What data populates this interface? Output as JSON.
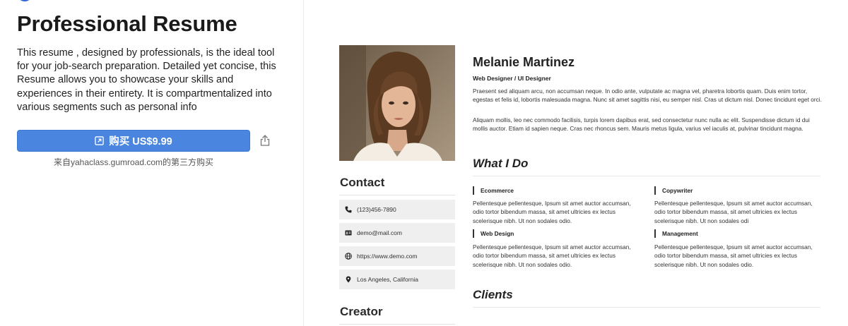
{
  "product": {
    "title": "Professional Resume",
    "description": "This resume , designed by professionals, is the ideal tool for your job-search preparation. Detailed yet concise, this Resume allows you to showcase your skills and experiences in their entirety. It is compartmentalized into various segments such as personal info",
    "buy_label": "购买 US$9.99",
    "source": "来自yahaclass.gumroad.com的第三方购买"
  },
  "resume": {
    "name": "Melanie Martinez",
    "role": "Web Designer / UI Designer",
    "para1": "Praesent sed aliquam arcu, non accumsan neque. In odio ante, vulputate ac magna vel, pharetra lobortis quam. Duis enim tortor, egestas et felis id, lobortis malesuada magna. Nunc sit amet sagittis nisi, eu semper nisl. Cras ut dictum nisl. Donec tincidunt eget orci.",
    "para2": "Aliquam mollis, leo nec commodo facilisis, turpis lorem dapibus erat, sed consectetur nunc nulla ac elit. Suspendisse dictum id dui mollis auctor. Etiam id sapien neque. Cras nec rhoncus sem. Mauris metus ligula, varius vel iaculis at, pulvinar tincidunt magna.",
    "contact_heading": "Contact",
    "contacts": [
      {
        "icon": "phone-icon",
        "text": "(123)456-7890"
      },
      {
        "icon": "id-card-icon",
        "text": "demo@mail.com"
      },
      {
        "icon": "globe-icon",
        "text": "https://www.demo.com"
      },
      {
        "icon": "location-pin-icon",
        "text": "Los Angeles, California"
      }
    ],
    "creator_heading": "Creator",
    "what_i_do_heading": "What I Do",
    "services": [
      {
        "title": "Ecommerce",
        "text": "Pellentesque pellentesque, Ipsum sit amet auctor accumsan, odio tortor bibendum massa, sit amet ultricies ex lectus scelerisque nibh. Ut non sodales odio."
      },
      {
        "title": "Copywriter",
        "text": "Pellentesque pellentesque, Ipsum sit amet auctor accumsan, odio tortor bibendum massa, sit amet ultricies ex lectus scelerisque nibh. Ut non sodales odi"
      },
      {
        "title": "Web Design",
        "text": "Pellentesque pellentesque, Ipsum sit amet auctor accumsan, odio tortor bibendum massa, sit amet ultricies ex lectus scelerisque nibh. Ut non sodales odio."
      },
      {
        "title": "Management",
        "text": "Pellentesque pellentesque, Ipsum sit amet auctor accumsan, odio tortor bibendum massa, sit amet ultricies ex lectus scelerisque nibh. Ut non sodales odio."
      }
    ],
    "clients_heading": "Clients"
  },
  "colors": {
    "buy_button": "#4a86e0",
    "contact_bg": "#efefef"
  }
}
